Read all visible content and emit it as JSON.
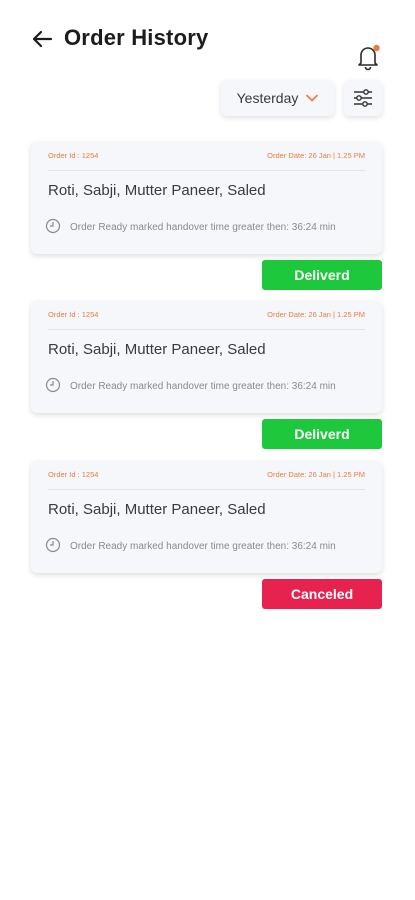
{
  "header": {
    "title": "Order History",
    "back_icon": "arrow-left-icon",
    "notification_icon": "bell-icon"
  },
  "filters": {
    "date_value": "Yesterday",
    "accent": "#f07a3a",
    "filter_icon": "sliders-icon"
  },
  "orders": [
    {
      "order_id": "Order Id : 1254",
      "order_date": "Order Date: 26 Jan | 1.25 PM",
      "items": "Roti, Sabji, Mutter Paneer, Saled",
      "note": "Order Ready marked handover time greater then: 36:24 min",
      "status": "Deliverd",
      "status_color": "#1ec83d"
    },
    {
      "order_id": "Order Id : 1254",
      "order_date": "Order Date: 26 Jan | 1.25 PM",
      "items": "Roti, Sabji, Mutter Paneer, Saled",
      "note": "Order Ready marked handover time greater then: 36:24 min",
      "status": "Deliverd",
      "status_color": "#1ec83d"
    },
    {
      "order_id": "Order Id : 1254",
      "order_date": "Order Date: 26 Jan | 1.25 PM",
      "items": "Roti, Sabji, Mutter Paneer, Saled",
      "note": "Order Ready marked handover time greater then: 36:24 min",
      "status": "Canceled",
      "status_color": "#e8224f"
    }
  ]
}
